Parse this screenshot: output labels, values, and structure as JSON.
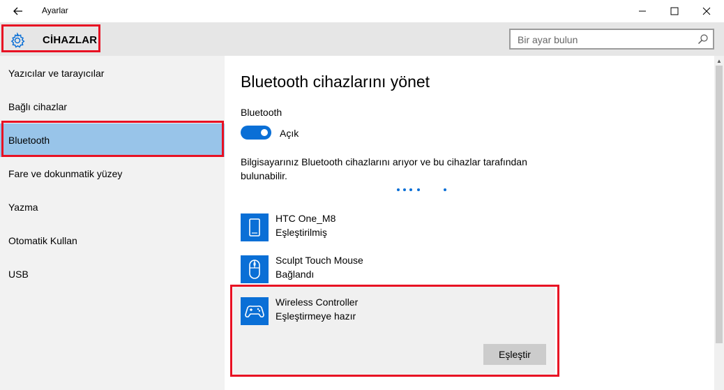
{
  "window": {
    "title": "Ayarlar",
    "back_icon": "back-arrow-icon",
    "controls": {
      "minimize": "—",
      "maximize": "☐",
      "close": "✕"
    }
  },
  "header": {
    "icon": "gear-icon",
    "title": "CİHAZLAR",
    "search": {
      "placeholder": "Bir ayar bulun",
      "value": "",
      "icon": "search-icon"
    }
  },
  "sidebar": {
    "items": [
      {
        "label": "Yazıcılar ve tarayıcılar",
        "selected": false
      },
      {
        "label": "Bağlı cihazlar",
        "selected": false
      },
      {
        "label": "Bluetooth",
        "selected": true
      },
      {
        "label": "Fare ve dokunmatik yüzey",
        "selected": false
      },
      {
        "label": "Yazma",
        "selected": false
      },
      {
        "label": "Otomatik Kullan",
        "selected": false
      },
      {
        "label": "USB",
        "selected": false
      }
    ]
  },
  "main": {
    "title": "Bluetooth cihazlarını yönet",
    "bluetooth_label": "Bluetooth",
    "toggle": {
      "on": true,
      "state_label": "Açık"
    },
    "description": "Bilgisayarınız Bluetooth cihazlarını arıyor ve bu cihazlar tarafından bulunabilir.",
    "devices": [
      {
        "name": "HTC One_M8",
        "status": "Eşleştirilmiş",
        "icon": "phone-icon"
      },
      {
        "name": "Sculpt Touch Mouse",
        "status": "Bağlandı",
        "icon": "mouse-icon"
      },
      {
        "name": "Wireless Controller",
        "status": "Eşleştirmeye hazır",
        "icon": "gamepad-icon"
      }
    ],
    "pair_button": "Eşleştir"
  },
  "colors": {
    "accent": "#0a6fd6",
    "selected_nav": "#98c4e9",
    "highlight_outline": "#e81123",
    "sidebar_bg": "#f2f2f2",
    "header_bg": "#e6e6e6"
  }
}
